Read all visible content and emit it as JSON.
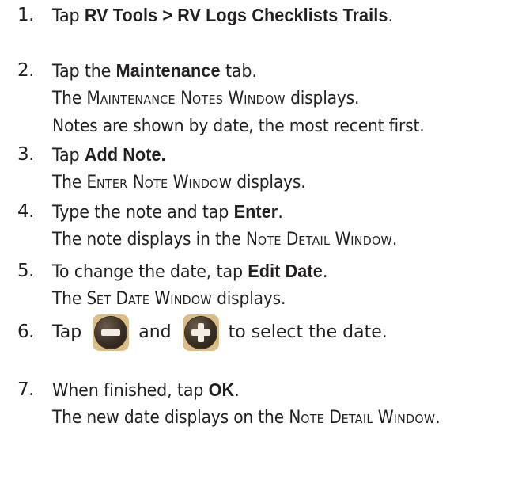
{
  "steps": [
    {
      "number": "1.",
      "lines": [
        {
          "pre": "Tap ",
          "bold": "RV Tools > RV Logs Checklists Trails",
          "post": "."
        }
      ]
    },
    {
      "number": "2.",
      "lines": [
        {
          "pre": "Tap the ",
          "bold": "Maintenance",
          "post": " tab."
        },
        {
          "pre": "The ",
          "caps": [
            "M",
            "AINTENANCE",
            " N",
            "OTES",
            " W",
            "INDOW"
          ],
          "post": " displays."
        },
        {
          "text": "Notes are shown by date, the most recent first."
        }
      ]
    },
    {
      "number": "3.",
      "lines": [
        {
          "pre": "Tap ",
          "bold": "Add Note."
        },
        {
          "pre": "The ",
          "caps": [
            "E",
            "NTER",
            " N",
            "OTE",
            " W",
            "INDO"
          ],
          "post": "w displays."
        }
      ]
    },
    {
      "number": "4.",
      "lines": [
        {
          "pre": "Type the note and tap ",
          "bold": "Enter",
          "post": "."
        },
        {
          "pre": "The note displays in the ",
          "caps": [
            "N",
            "OTE",
            " D",
            "ETAIL",
            " W",
            "INDOW"
          ],
          "post": "."
        }
      ]
    },
    {
      "number": "5.",
      "lines": [
        {
          "pre": "To change the date, tap ",
          "bold": "Edit Date",
          "post": "."
        },
        {
          "pre": "The ",
          "caps": [
            "S",
            "ET",
            " D",
            "ATE",
            " W",
            "INDOW"
          ],
          "post": " displays."
        }
      ]
    },
    {
      "number": "6.",
      "icon_line": {
        "pre": "Tap",
        "icon1": "minus-circle-icon",
        "mid": "and",
        "icon2": "plus-circle-icon",
        "post": "to select the date."
      }
    },
    {
      "number": "7.",
      "lines": [
        {
          "pre": "When finished, tap ",
          "bold": "OK",
          "post": "."
        },
        {
          "pre": "The new date displays on the ",
          "caps": [
            "N",
            "OTE",
            " D",
            "ETAIL",
            " W",
            "INDOW"
          ],
          "post": "."
        }
      ]
    }
  ],
  "colors": {
    "text": "#231f20",
    "icon_tile": "#dcbd86",
    "icon_disc": "#3a2f25",
    "icon_glyph": "#f2ece3"
  }
}
